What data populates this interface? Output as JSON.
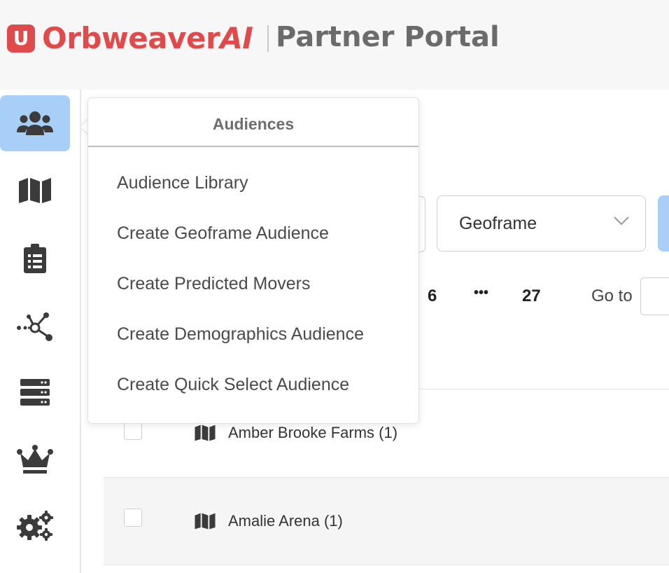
{
  "header": {
    "logo_letter": "U",
    "brand_main": "Orbweaver",
    "brand_suffix": "AI",
    "portal_title": "Partner Portal",
    "brand_color": "#e04a4a"
  },
  "sidebar": {
    "items": [
      {
        "icon": "users-icon",
        "active": true
      },
      {
        "icon": "map-icon",
        "active": false
      },
      {
        "icon": "clipboard-list-icon",
        "active": false
      },
      {
        "icon": "network-icon",
        "active": false
      },
      {
        "icon": "server-icon",
        "active": false
      },
      {
        "icon": "crown-icon",
        "active": false
      },
      {
        "icon": "cogs-icon",
        "active": false
      }
    ],
    "active_color": "#a8cff8"
  },
  "popover": {
    "title": "Audiences",
    "items": [
      "Audience Library",
      "Create Geoframe Audience",
      "Create Predicted Movers",
      "Create Demographics Audience",
      "Create Quick Select Audience"
    ]
  },
  "filters": {
    "type_select_value": "Geoframe"
  },
  "pagination": {
    "pages": [
      "6",
      "•••",
      "27"
    ],
    "goto_label": "Go to"
  },
  "rows": [
    {
      "name": "Amber Brooke Farms (1)",
      "icon": "map-icon"
    },
    {
      "name": "Amalie Arena (1)",
      "icon": "map-icon"
    }
  ]
}
